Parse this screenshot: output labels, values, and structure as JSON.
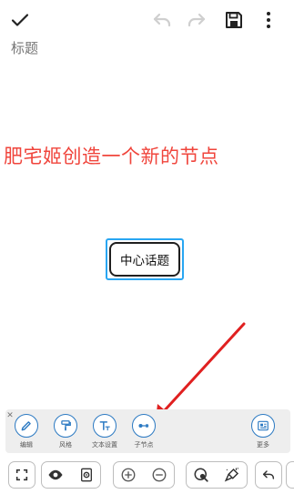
{
  "editor": {
    "title_placeholder": "标题"
  },
  "canvas": {
    "annotation": "肥宅姬创造一个新的节点",
    "root_node": "中心话题"
  },
  "node_toolbar": {
    "items": [
      {
        "label": "编辑",
        "icon": "pencil-icon"
      },
      {
        "label": "风格",
        "icon": "paint-roller-icon"
      },
      {
        "label": "文本设置",
        "icon": "text-format-icon"
      },
      {
        "label": "子节点",
        "icon": "add-child-node-icon"
      },
      {
        "label": "更多",
        "icon": "more-panel-icon"
      }
    ]
  },
  "colors": {
    "accent": "#2b79c2",
    "annotation": "#f0453c",
    "selection": "#29a6f2",
    "arrow": "#e02020"
  }
}
